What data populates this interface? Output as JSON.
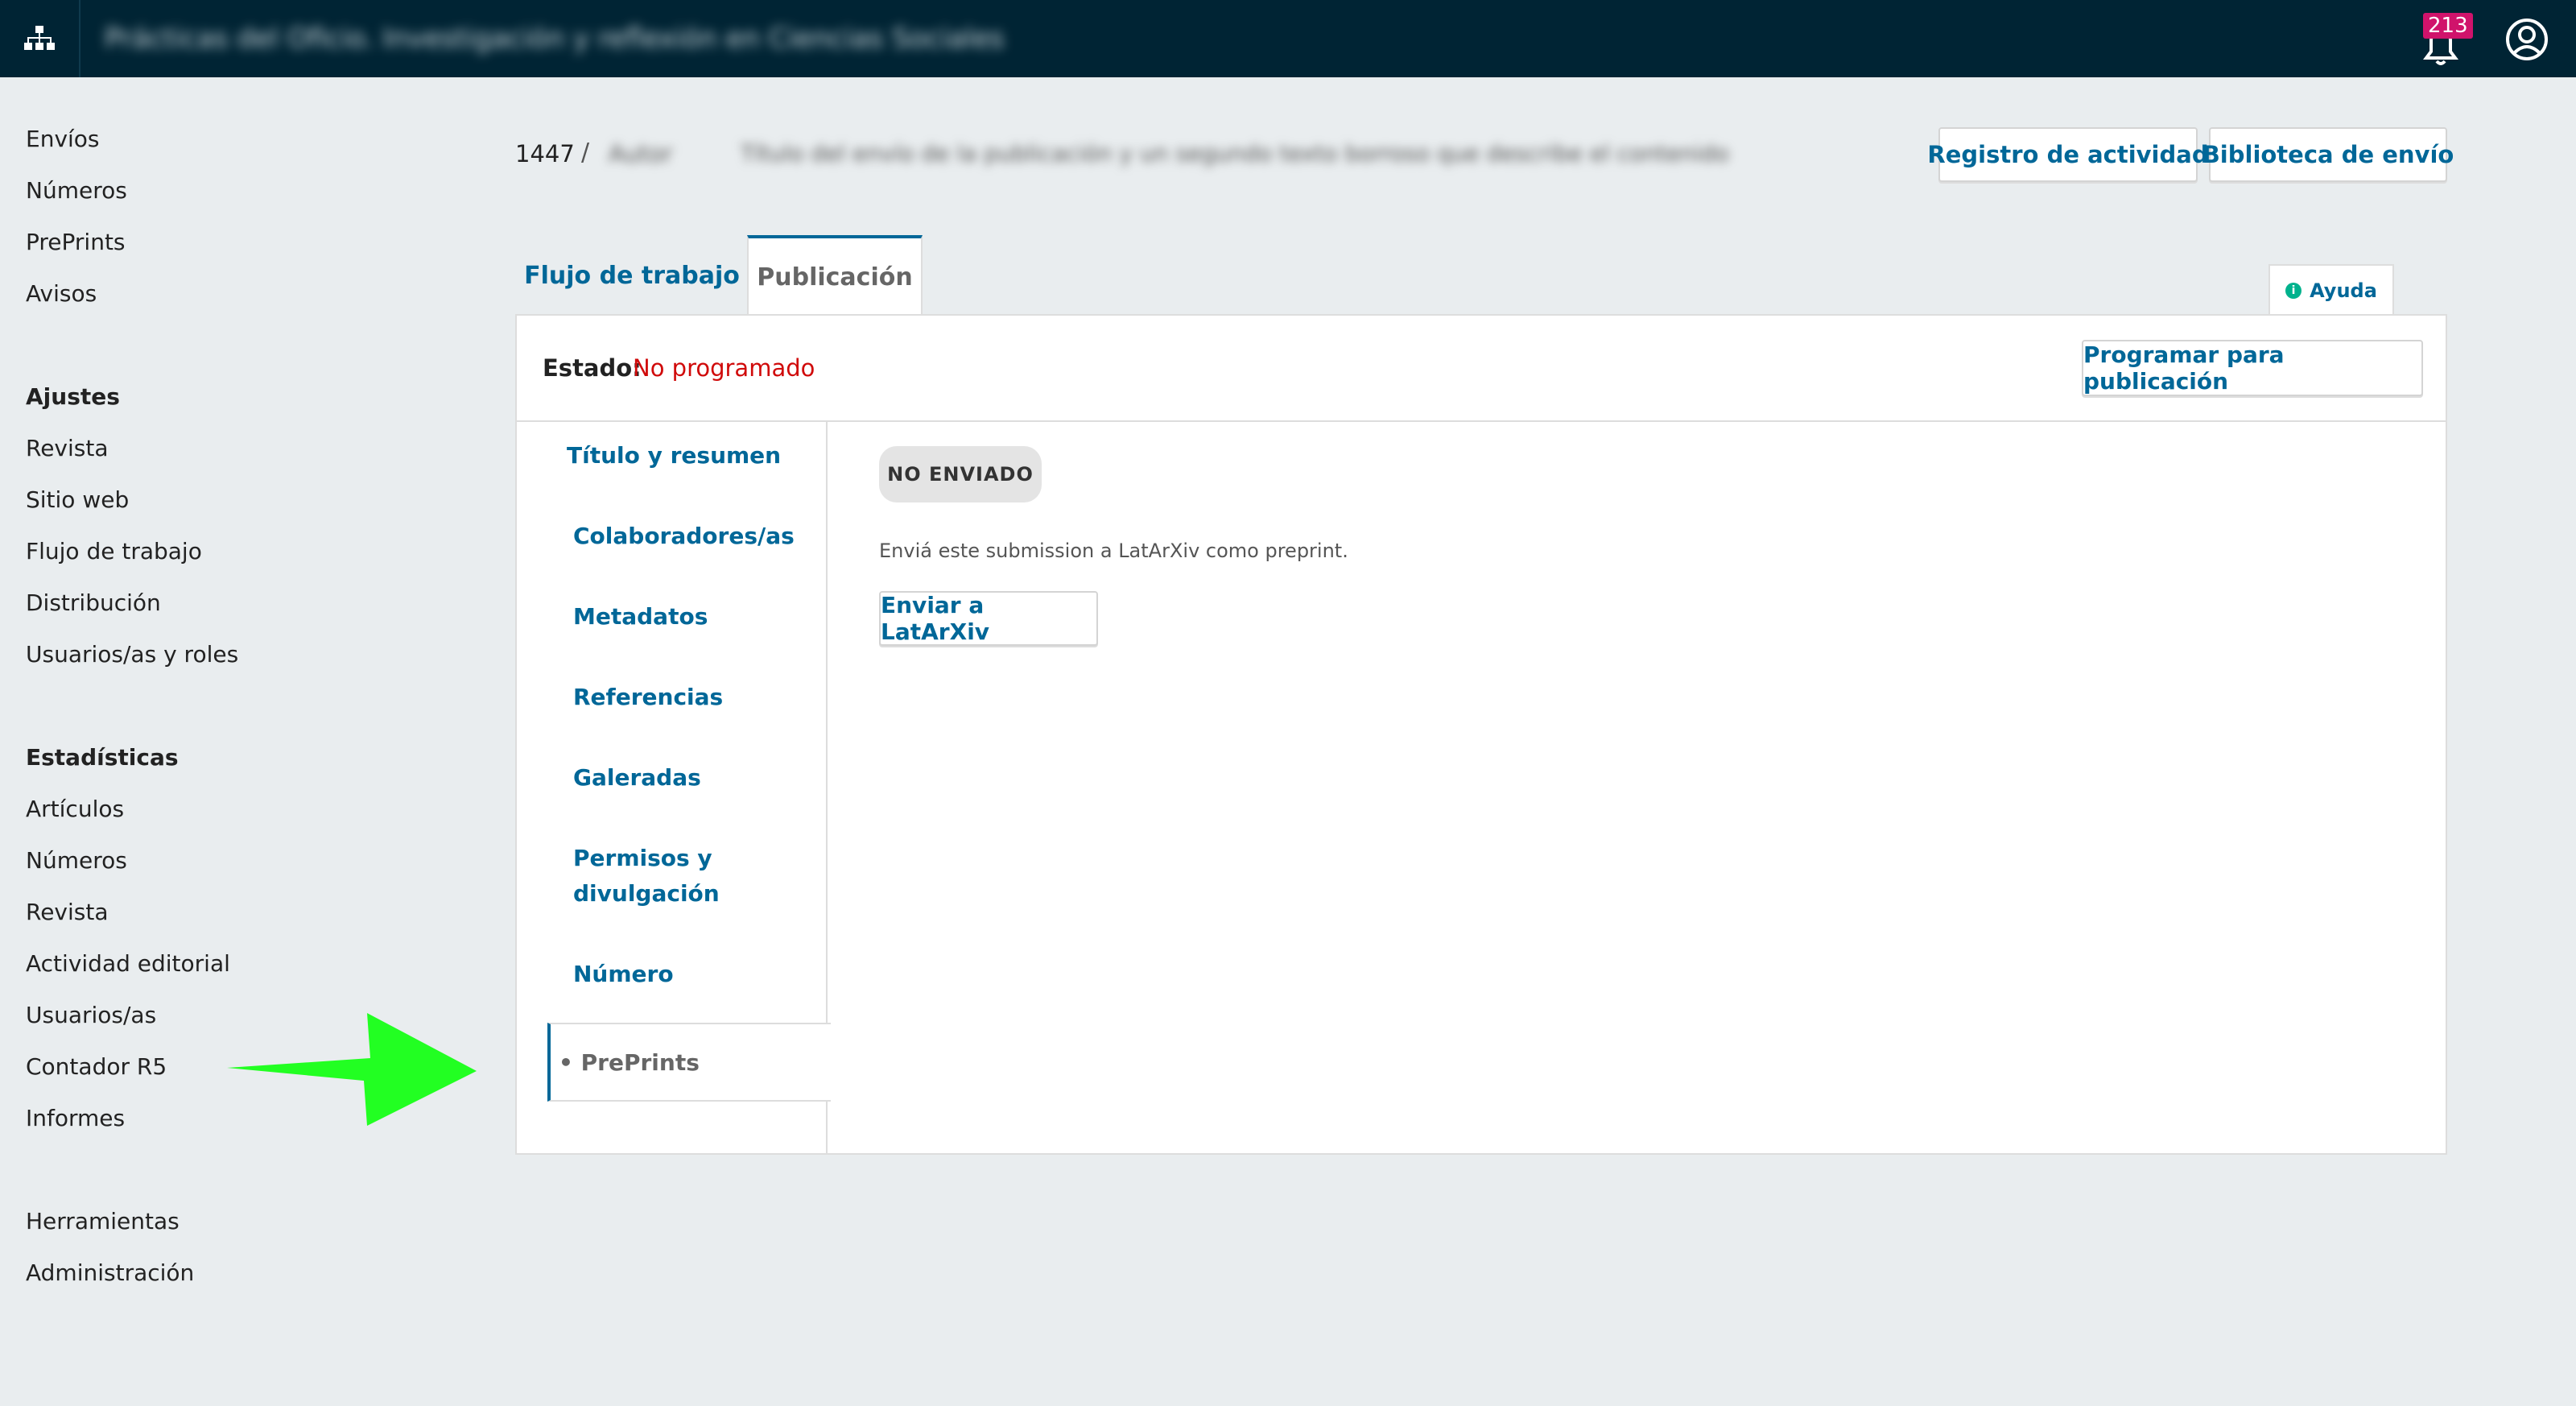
{
  "topbar": {
    "journal_title": "Prácticas del Oficio. Investigación y reflexión en Ciencias Sociales",
    "notification_count": "213"
  },
  "sidebar": {
    "items_main": [
      "Envíos",
      "Números",
      "PrePrints",
      "Avisos"
    ],
    "settings_heading": "Ajustes",
    "settings_items": [
      "Revista",
      "Sitio web",
      "Flujo de trabajo",
      "Distribución",
      "Usuarios/as y roles"
    ],
    "stats_heading": "Estadísticas",
    "stats_items": [
      "Artículos",
      "Números",
      "Revista",
      "Actividad editorial",
      "Usuarios/as",
      "Contador R5",
      "Informes"
    ],
    "tools_items": [
      "Herramientas",
      "Administración"
    ]
  },
  "breadcrumb": {
    "submission_id": "1447",
    "separator": "/",
    "author": "Autor",
    "title": "Título del envío de la publicación y un segundo texto borroso que describe el contenido"
  },
  "header": {
    "activity_log_label": "Registro de actividad",
    "library_label": "Biblioteca de envío"
  },
  "tabs": {
    "workflow": "Flujo de trabajo",
    "publication": "Publicación",
    "help": "Ayuda"
  },
  "status": {
    "label": "Estado:",
    "value": "No programado",
    "schedule_button": "Programar para publicación"
  },
  "subnav": {
    "items": [
      "Título y resumen",
      "Colaboradores/as",
      "Metadatos",
      "Referencias",
      "Galeradas",
      "Permisos y divulgación",
      "Número"
    ],
    "active": "• PrePrints"
  },
  "preprint": {
    "badge": "NO ENVIADO",
    "description": "Enviá este submission a LatArXiv como preprint.",
    "send_button": "Enviar a LatArXiv"
  },
  "colors": {
    "topbar": "#002434",
    "link": "#006798",
    "status_error": "#d00a0a",
    "notification": "#d0136b",
    "annotation_arrow": "#22ff22"
  }
}
